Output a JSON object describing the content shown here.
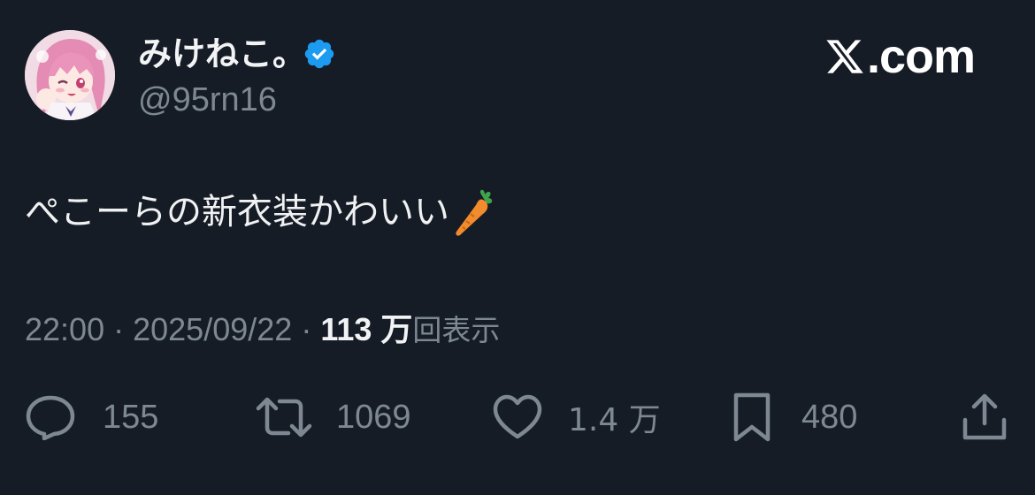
{
  "header": {
    "display_name": "みけねこ。",
    "handle": "@95rn16",
    "verified": true,
    "brand": "X.com"
  },
  "tweet": {
    "text": "ぺこーらの新衣装かわいい",
    "emoji": "carrot"
  },
  "meta": {
    "time": "22:00",
    "separator": "·",
    "date": "2025/09/22",
    "views_count": "113 万",
    "views_label": "回表示"
  },
  "actions": {
    "replies": "155",
    "reposts": "1069",
    "likes": "1.4 万",
    "bookmarks": "480"
  },
  "colors": {
    "background": "#161c26",
    "text": "#e7e9ea",
    "muted": "#7d8893",
    "verified": "#1d9bf0"
  }
}
